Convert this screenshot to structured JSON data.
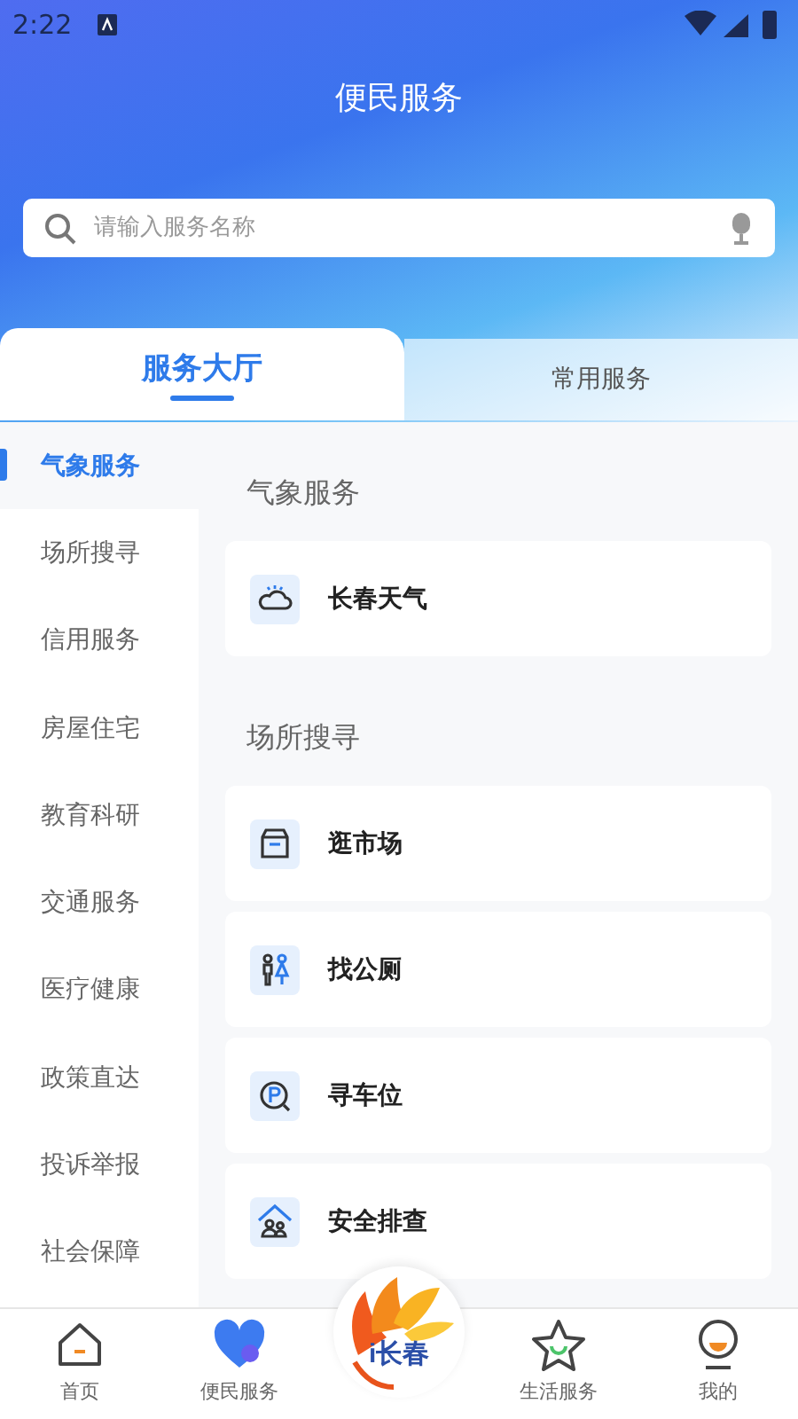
{
  "status_bar": {
    "time": "2:22"
  },
  "header": {
    "title": "便民服务"
  },
  "search": {
    "placeholder": "请输入服务名称"
  },
  "tabs": [
    {
      "label": "服务大厅",
      "selected": true
    },
    {
      "label": "常用服务",
      "selected": false
    }
  ],
  "sidebar": {
    "items": [
      {
        "label": "气象服务",
        "selected": true
      },
      {
        "label": "场所搜寻",
        "selected": false
      },
      {
        "label": "信用服务",
        "selected": false
      },
      {
        "label": "房屋住宅",
        "selected": false
      },
      {
        "label": "教育科研",
        "selected": false
      },
      {
        "label": "交通服务",
        "selected": false
      },
      {
        "label": "医疗健康",
        "selected": false
      },
      {
        "label": "政策直达",
        "selected": false
      },
      {
        "label": "投诉举报",
        "selected": false
      },
      {
        "label": "社会保障",
        "selected": false
      }
    ]
  },
  "sections": [
    {
      "title": "气象服务",
      "items": [
        {
          "kind": "weather",
          "label": "长春天气"
        }
      ]
    },
    {
      "title": "场所搜寻",
      "items": [
        {
          "kind": "shop",
          "label": "逛市场"
        },
        {
          "kind": "toilet",
          "label": "找公厕"
        },
        {
          "kind": "parking",
          "label": "寻车位"
        },
        {
          "kind": "house",
          "label": "安全排查"
        }
      ]
    }
  ],
  "bottom_nav": [
    {
      "kind": "home",
      "label": "首页",
      "selected": false
    },
    {
      "kind": "heart",
      "label": "便民服务",
      "selected": true
    },
    {
      "kind": "logo",
      "label": "i长春",
      "selected": false
    },
    {
      "kind": "star",
      "label": "生活服务",
      "selected": false
    },
    {
      "kind": "person",
      "label": "我的",
      "selected": false
    }
  ]
}
